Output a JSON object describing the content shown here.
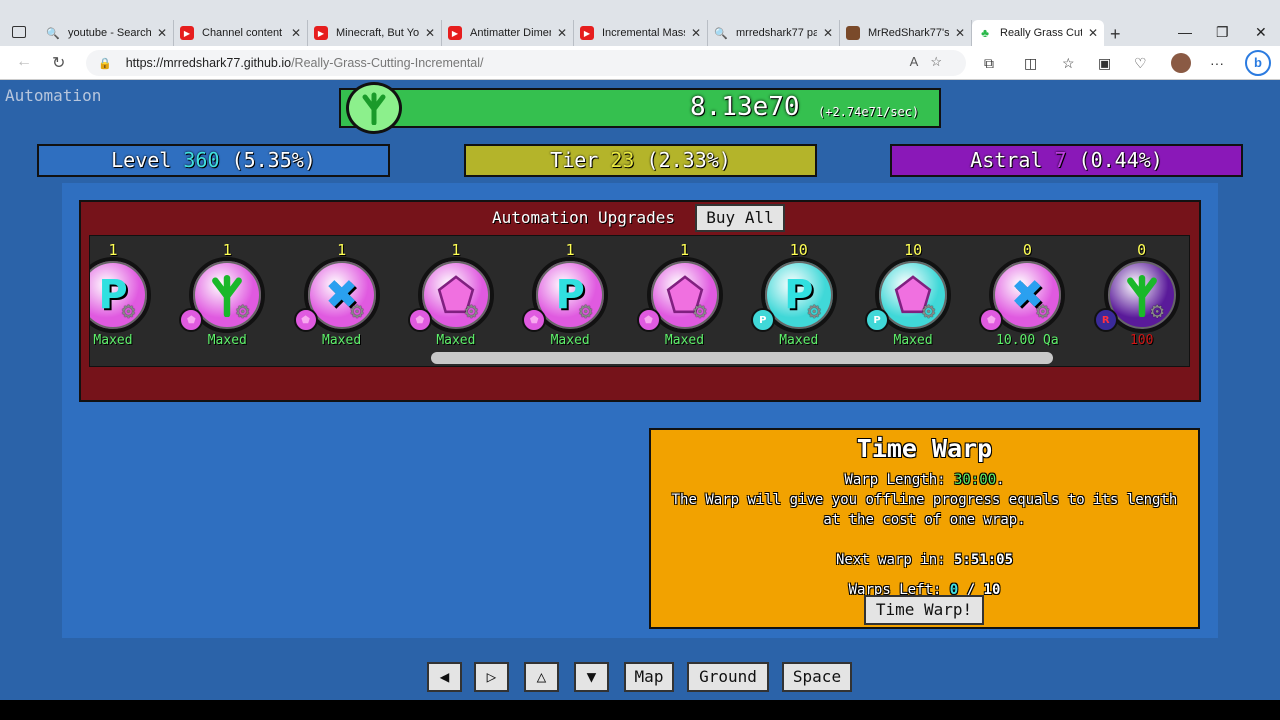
{
  "browser": {
    "tabs": [
      {
        "title": "youtube - Search",
        "favicon": "search"
      },
      {
        "title": "Channel content -",
        "favicon": "youtube"
      },
      {
        "title": "Minecraft, But You",
        "favicon": "youtube"
      },
      {
        "title": "Antimatter Dimen",
        "favicon": "youtube"
      },
      {
        "title": "Incremental Mass",
        "favicon": "youtube"
      },
      {
        "title": "mrredshark77 pa",
        "favicon": "search"
      },
      {
        "title": "MrRedShark77's I",
        "favicon": "image"
      },
      {
        "title": "Really Grass Cuttin",
        "favicon": "grass",
        "active": true
      }
    ],
    "url_host": "https://mrredshark77.github.io",
    "url_path": "/Really-Grass-Cutting-Incremental/"
  },
  "game": {
    "automation_label": "Automation",
    "grass": {
      "amount": "8.13e70",
      "rate": "(+2.74e71/sec)",
      "bar_color": "#35c04f"
    },
    "level": {
      "label": "Level",
      "value": "360",
      "percent": "(5.35%)",
      "color": "#2f6fc0",
      "value_color": "#40e0e0"
    },
    "tier": {
      "label": "Tier",
      "value": "23",
      "percent": "(2.33%)",
      "color": "#b4b42a",
      "value_color": "#e8e840"
    },
    "astral": {
      "label": "Astral",
      "value": "7",
      "percent": "(0.44%)",
      "color": "#8a18b8",
      "value_color": "#c040e0"
    },
    "automation_upgrades": {
      "title": "Automation Upgrades",
      "buy_all": "Buy All",
      "items": [
        {
          "level": "1",
          "status": "Maxed",
          "symbol": "P",
          "bg": "#e05ae0",
          "badge": "",
          "status_red": false
        },
        {
          "level": "1",
          "status": "Maxed",
          "symbol": "grass",
          "bg": "#e05ae0",
          "badge": "gem",
          "status_red": false
        },
        {
          "level": "1",
          "status": "Maxed",
          "symbol": "X",
          "bg": "#e05ae0",
          "badge": "gem",
          "status_red": false
        },
        {
          "level": "1",
          "status": "Maxed",
          "symbol": "gem",
          "bg": "#e05ae0",
          "badge": "gem",
          "status_red": false
        },
        {
          "level": "1",
          "status": "Maxed",
          "symbol": "P",
          "bg": "#e05ae0",
          "badge": "gem",
          "status_red": false
        },
        {
          "level": "1",
          "status": "Maxed",
          "symbol": "gem",
          "bg": "#e05ae0",
          "badge": "gem",
          "status_red": false
        },
        {
          "level": "10",
          "status": "Maxed",
          "symbol": "P",
          "bg": "#40d8d8",
          "badge": "P",
          "status_red": false
        },
        {
          "level": "10",
          "status": "Maxed",
          "symbol": "gem",
          "bg": "#40d8d8",
          "badge": "P",
          "status_red": false
        },
        {
          "level": "0",
          "status": "10.00 Qa",
          "symbol": "X",
          "bg": "#e05ae0",
          "badge": "gem",
          "status_red": false
        },
        {
          "level": "0",
          "status": "100",
          "symbol": "grass",
          "bg": "#5a1a9a",
          "badge": "R",
          "status_red": true
        }
      ]
    },
    "time_warp": {
      "title": "Time Warp",
      "length_label": "Warp Length:",
      "length_value": "30:00",
      "desc1": "The Warp will give you offline progress equals to its length",
      "desc2": "at the cost of one wrap.",
      "next_label": "Next warp in:",
      "next_value": "5:51:05",
      "left_label": "Warps Left:",
      "left_value": "0",
      "left_max": "/ 10",
      "button": "Time Warp!"
    },
    "nav": {
      "left": "◀",
      "right": "▷",
      "up": "△",
      "down": "▼",
      "map": "Map",
      "ground": "Ground",
      "space": "Space"
    }
  }
}
